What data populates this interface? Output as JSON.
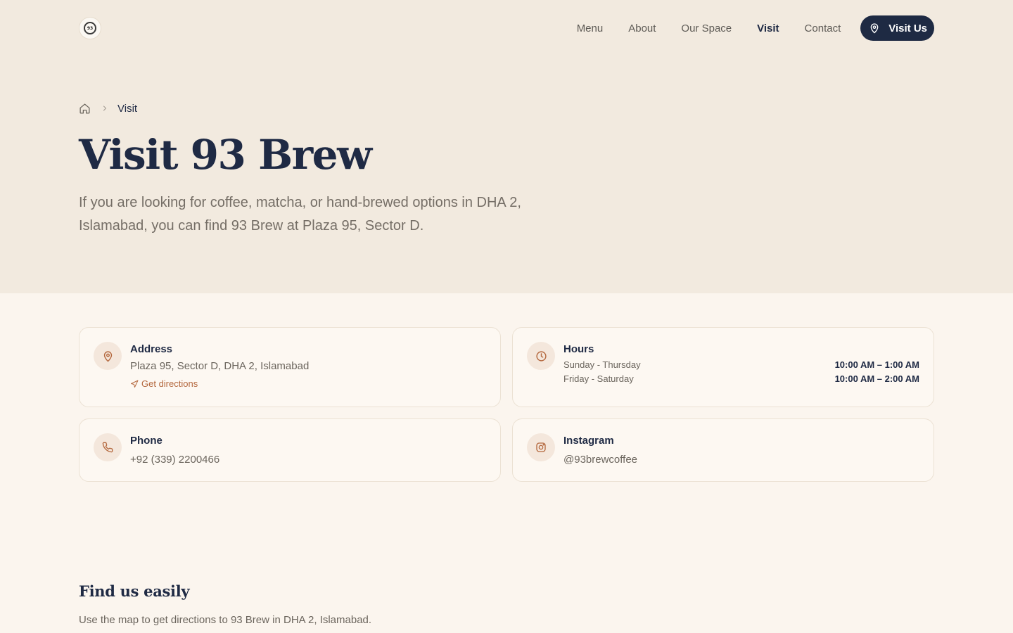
{
  "brand": {
    "logo_text": "93"
  },
  "nav": {
    "links": [
      "Menu",
      "About",
      "Our Space",
      "Visit",
      "Contact"
    ],
    "active": "Visit",
    "cta_label": "Visit Us"
  },
  "breadcrumb": {
    "current": "Visit"
  },
  "hero": {
    "title": "Visit 93 Brew",
    "lead": "If you are looking for coffee, matcha, or hand-brewed options in DHA 2, Islamabad, you can find 93 Brew at Plaza 95, Sector D."
  },
  "address": {
    "label": "Address",
    "value": "Plaza 95, Sector D, DHA 2, Islamabad",
    "link": "Get directions"
  },
  "hours": {
    "label": "Hours",
    "rows": [
      {
        "days": "Sunday - Thursday",
        "time": "10:00 AM – 1:00 AM"
      },
      {
        "days": "Friday - Saturday",
        "time": "10:00 AM – 2:00 AM"
      }
    ]
  },
  "phone": {
    "label": "Phone",
    "value": "+92 (339) 2200466"
  },
  "instagram": {
    "label": "Instagram",
    "value": "@93brewcoffee"
  },
  "find": {
    "title": "Find us easily",
    "subtitle": "Use the map to get directions to 93 Brew in DHA 2, Islamabad."
  },
  "colors": {
    "hero_bg": "#f2eadf",
    "page_bg": "#fbf5ee",
    "navy": "#1e2a43",
    "accent": "#b4683e"
  },
  "icons": {
    "logo": "brand-logo-icon",
    "cta": "map-pin-icon",
    "breadcrumb_home": "home-icon",
    "breadcrumb_sep": "chevron-right-icon",
    "address": "map-pin-icon",
    "directions": "navigation-arrow-icon",
    "hours": "clock-icon",
    "phone": "phone-icon",
    "instagram": "instagram-icon"
  }
}
